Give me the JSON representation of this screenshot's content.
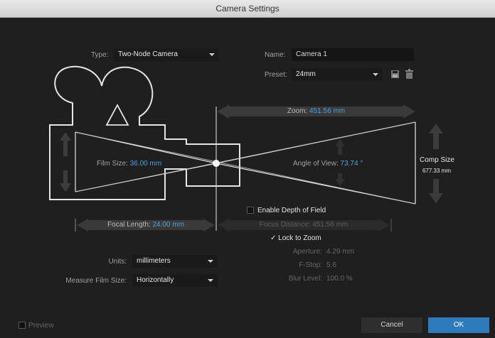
{
  "window": {
    "title": "Camera Settings"
  },
  "type": {
    "label": "Type:",
    "value": "Two-Node Camera"
  },
  "name": {
    "label": "Name:",
    "value": "Camera 1"
  },
  "preset": {
    "label": "Preset:",
    "value": "24mm"
  },
  "zoom": {
    "label": "Zoom:",
    "value": "451.56 mm"
  },
  "film_size": {
    "label": "Film Size:",
    "value": "36.00 mm"
  },
  "angle_of_view": {
    "label": "Angle of View:",
    "value": "73.74 °"
  },
  "comp_size": {
    "label": "Comp Size",
    "value": "677.33 mm"
  },
  "focal_length": {
    "label": "Focal Length:",
    "value": "24.00 mm"
  },
  "depth_of_field": {
    "label": "Enable Depth of Field",
    "checked": false
  },
  "focus_distance": {
    "label": "Focus Distance:",
    "value": "451.56 mm"
  },
  "lock_to_zoom": {
    "label": "Lock to Zoom",
    "checked": true,
    "check_mark": "✓"
  },
  "aperture": {
    "label": "Aperture:",
    "value": "4.29 mm"
  },
  "fstop": {
    "label": "F-Stop:",
    "value": "5.6"
  },
  "blur_level": {
    "label": "Blur Level:",
    "value": "100.0 %"
  },
  "units": {
    "label": "Units:",
    "value": "millimeters"
  },
  "measure_film_size": {
    "label": "Measure Film Size:",
    "value": "Horizontally"
  },
  "preview": {
    "label": "Preview",
    "checked": false
  },
  "buttons": {
    "cancel": "Cancel",
    "ok": "OK"
  },
  "colors": {
    "dialog_bg": "#1f1f1f",
    "accent": "#4aa3df",
    "ok_button": "#2d7bbd"
  },
  "icons": {
    "save_preset": "save-preset-icon",
    "delete_preset": "trash-icon"
  }
}
